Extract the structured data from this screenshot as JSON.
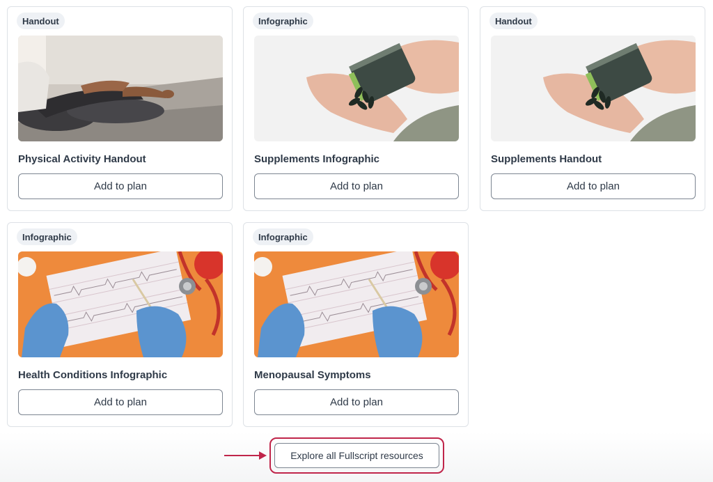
{
  "cards": [
    {
      "badge": "Handout",
      "title": "Physical Activity Handout",
      "button": "Add to plan",
      "image": "yoga-meditation-image"
    },
    {
      "badge": "Infographic",
      "title": "Supplements Infographic",
      "button": "Add to plan",
      "image": "supplement-capsules-image"
    },
    {
      "badge": "Handout",
      "title": "Supplements Handout",
      "button": "Add to plan",
      "image": "supplement-capsules-image"
    },
    {
      "badge": "Infographic",
      "title": "Health Conditions Infographic",
      "button": "Add to plan",
      "image": "ecg-chart-gloves-image"
    },
    {
      "badge": "Infographic",
      "title": "Menopausal Symptoms",
      "button": "Add to plan",
      "image": "ecg-chart-gloves-image"
    }
  ],
  "explore": {
    "label": "Explore all Fullscript resources"
  },
  "colors": {
    "highlight": "#c0254a",
    "badge_bg": "#eef1f5",
    "text": "#2f3a48",
    "border": "#dde1e6"
  },
  "icons": {
    "pointer": "arrow-right-icon"
  }
}
